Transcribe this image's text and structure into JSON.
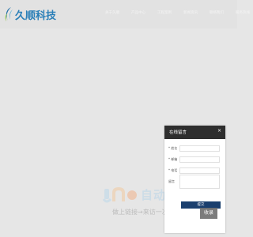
{
  "brand": {
    "name": "久顺科技",
    "color": "#2a7fb8"
  },
  "nav": {
    "items": [
      "关于久顺",
      "产品中心",
      "工程案例",
      "新闻资讯",
      "联络我们",
      "服务热线"
    ]
  },
  "watermark": {
    "big": "自动秒收录",
    "sub": "做上链接→来访一次→自动收录"
  },
  "chat": {
    "title": "在线留言",
    "close": "×",
    "fields": [
      {
        "label": "* 姓名"
      },
      {
        "label": "* 邮箱"
      },
      {
        "label": "* 电话"
      },
      {
        "label": "留言"
      }
    ],
    "submit": "提交",
    "header_color": "#2e2e2e",
    "submit_color": "#1a3f6e"
  },
  "badge": {
    "text": "收录"
  }
}
